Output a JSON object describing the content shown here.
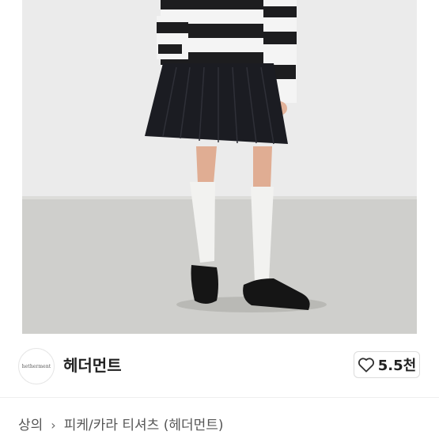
{
  "image": {
    "alt_icon": "product-photo"
  },
  "brand": {
    "logo_text": "hetherment",
    "name": "헤더먼트"
  },
  "like": {
    "icon": "heart-outline-icon",
    "count": "5.5천"
  },
  "breadcrumb": {
    "category": "상의",
    "separator_icon": "chevron-right-icon",
    "subcategory": "피케/카라 티셔츠 (헤더먼트)"
  }
}
